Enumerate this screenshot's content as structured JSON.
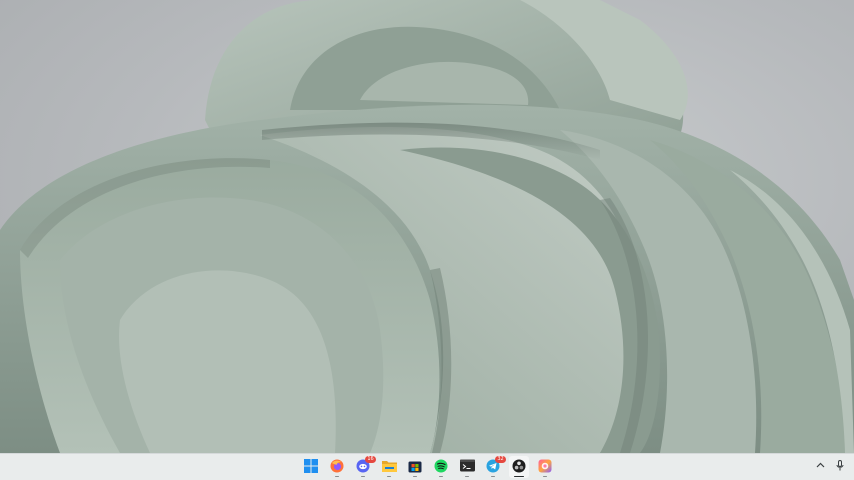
{
  "wallpaper": {
    "name": "windows-11-bloom-wallpaper",
    "colors": {
      "background": "#b6b9bc",
      "petal_light": "#a9b7ae",
      "petal_mid": "#8fa095",
      "petal_dark": "#6f7f75",
      "petal_highlight": "#c6cfc8"
    }
  },
  "taskbar": {
    "background": "#e9ecec",
    "apps": [
      {
        "id": "start",
        "icon": "windows-start-icon",
        "running": false,
        "active": false,
        "badge": ""
      },
      {
        "id": "firefox",
        "icon": "firefox-icon",
        "running": true,
        "active": false,
        "badge": ""
      },
      {
        "id": "discord",
        "icon": "discord-icon",
        "running": true,
        "active": false,
        "badge": "16"
      },
      {
        "id": "file-explorer",
        "icon": "folder-icon",
        "running": true,
        "active": false,
        "badge": ""
      },
      {
        "id": "microsoft-store",
        "icon": "store-icon",
        "running": true,
        "active": false,
        "badge": ""
      },
      {
        "id": "spotify",
        "icon": "spotify-icon",
        "running": true,
        "active": false,
        "badge": ""
      },
      {
        "id": "terminal",
        "icon": "terminal-icon",
        "running": true,
        "active": false,
        "badge": ""
      },
      {
        "id": "telegram",
        "icon": "telegram-icon",
        "running": true,
        "active": false,
        "badge": "32"
      },
      {
        "id": "obs",
        "icon": "obs-icon",
        "running": true,
        "active": true,
        "badge": ""
      },
      {
        "id": "photos",
        "icon": "photos-icon",
        "running": true,
        "active": false,
        "badge": ""
      }
    ],
    "tray": [
      {
        "icon": "chevron-up-icon"
      },
      {
        "icon": "microphone-icon"
      }
    ]
  }
}
